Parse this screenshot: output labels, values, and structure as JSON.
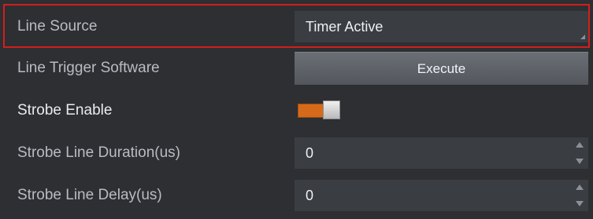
{
  "rows": [
    {
      "label": "Line Source",
      "value": "Timer Active",
      "control": "dropdown"
    },
    {
      "label": "Line Trigger Software",
      "button_label": "Execute",
      "control": "button"
    },
    {
      "label": "Strobe Enable",
      "control": "toggle",
      "state": "on"
    },
    {
      "label": "Strobe Line Duration(us)",
      "value": "0",
      "control": "spinbox"
    },
    {
      "label": "Strobe Line Delay(us)",
      "value": "0",
      "control": "spinbox"
    }
  ],
  "colors": {
    "highlight_border": "#d0201c",
    "toggle_on": "#d66a1b",
    "background": "#2d2f33"
  }
}
